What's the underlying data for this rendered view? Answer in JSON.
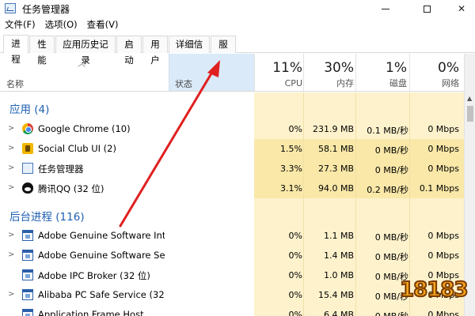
{
  "window": {
    "title": "任务管理器"
  },
  "menu": [
    "文件(F)",
    "选项(O)",
    "查看(V)"
  ],
  "tabs": [
    "进程",
    "性能",
    "应用历史记录",
    "启动",
    "用户",
    "详细信息",
    "服务"
  ],
  "header": {
    "name": "名称",
    "status": "状态",
    "cpu": {
      "pct": "11%",
      "label": "CPU"
    },
    "mem": {
      "pct": "30%",
      "label": "内存"
    },
    "disk": {
      "pct": "1%",
      "label": "磁盘"
    },
    "net": {
      "pct": "0%",
      "label": "网络"
    }
  },
  "groups": {
    "apps": "应用 (4)",
    "background": "后台进程 (116)"
  },
  "apps": [
    {
      "name": "Google Chrome (10)",
      "icon": "chrome-icon",
      "cpu": "0%",
      "mem": "231.9 MB",
      "disk": "0.1 MB/秒",
      "net": "0 Mbps"
    },
    {
      "name": "Social Club UI (2)",
      "icon": "social-club-icon",
      "cpu": "1.5%",
      "mem": "58.1 MB",
      "disk": "0 MB/秒",
      "net": "0 Mbps"
    },
    {
      "name": "任务管理器",
      "icon": "task-manager-icon",
      "cpu": "3.3%",
      "mem": "27.3 MB",
      "disk": "0 MB/秒",
      "net": "0 Mbps"
    },
    {
      "name": "腾讯QQ (32 位)",
      "icon": "qq-icon",
      "cpu": "3.1%",
      "mem": "94.0 MB",
      "disk": "0.2 MB/秒",
      "net": "0.1 Mbps"
    }
  ],
  "background": [
    {
      "name": "Adobe Genuine Software Int...",
      "cpu": "0%",
      "mem": "1.1 MB",
      "disk": "0 MB/秒",
      "net": "0 Mbps",
      "chev": true
    },
    {
      "name": "Adobe Genuine Software Ser...",
      "cpu": "0%",
      "mem": "1.4 MB",
      "disk": "0 MB/秒",
      "net": "0 Mbps",
      "chev": true
    },
    {
      "name": "Adobe IPC Broker (32 位)",
      "cpu": "0%",
      "mem": "1.0 MB",
      "disk": "0 MB/秒",
      "net": "0 Mbps",
      "chev": false
    },
    {
      "name": "Alibaba PC Safe Service (32 ...",
      "cpu": "0%",
      "mem": "15.4 MB",
      "disk": "0 MB/秒",
      "net": "0 Mbps",
      "chev": true
    },
    {
      "name": "Application Frame Host",
      "cpu": "0%",
      "mem": "6.4 MB",
      "disk": "0 MB/秒",
      "net": "0 Mbps",
      "chev": false
    }
  ],
  "watermark": "18183",
  "colors": {
    "accent": "#1e5fb3",
    "annotation": "#e02020",
    "metric_bg": "#fdf2cc"
  }
}
